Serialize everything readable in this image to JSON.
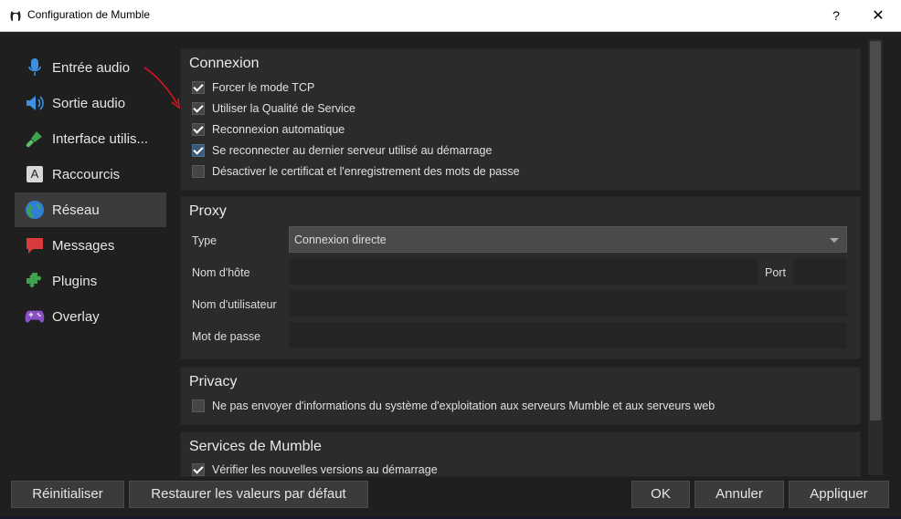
{
  "window": {
    "title": "Configuration de Mumble",
    "help_label": "?",
    "close_label": "✕"
  },
  "sidebar": {
    "items": [
      {
        "label": "Entrée audio",
        "icon": "microphone-icon",
        "active": false
      },
      {
        "label": "Sortie audio",
        "icon": "speaker-icon",
        "active": false
      },
      {
        "label": "Interface utilis...",
        "icon": "paintbrush-icon",
        "active": false
      },
      {
        "label": "Raccourcis",
        "icon": "keyboard-key-icon",
        "key_glyph": "A",
        "active": false
      },
      {
        "label": "Réseau",
        "icon": "globe-icon",
        "active": true
      },
      {
        "label": "Messages",
        "icon": "speech-bubble-icon",
        "active": false
      },
      {
        "label": "Plugins",
        "icon": "puzzle-icon",
        "active": false
      },
      {
        "label": "Overlay",
        "icon": "gamepad-icon",
        "active": false
      }
    ]
  },
  "connexion": {
    "title": "Connexion",
    "options": [
      {
        "label": "Forcer le mode TCP",
        "checked": true
      },
      {
        "label": "Utiliser la Qualité de Service",
        "checked": true
      },
      {
        "label": "Reconnexion automatique",
        "checked": true
      },
      {
        "label": "Se reconnecter au dernier serveur utilisé au démarrage",
        "checked": true
      },
      {
        "label": "Désactiver le certificat et l'enregistrement des mots de passe",
        "checked": false
      }
    ]
  },
  "proxy": {
    "title": "Proxy",
    "type_label": "Type",
    "type_value": "Connexion directe",
    "host_label": "Nom d'hôte",
    "host_value": "",
    "port_label": "Port",
    "port_value": "",
    "user_label": "Nom d'utilisateur",
    "user_value": "",
    "password_label": "Mot de passe",
    "password_value": ""
  },
  "privacy": {
    "title": "Privacy",
    "option_label": "Ne pas envoyer d'informations du système d'exploitation aux serveurs Mumble et aux serveurs web",
    "option_checked": false
  },
  "services": {
    "title": "Services de Mumble",
    "option_label": "Vérifier les nouvelles versions au démarrage",
    "option_checked": true
  },
  "buttons": {
    "reset": "Réinitialiser",
    "defaults": "Restaurer les valeurs par défaut",
    "ok": "OK",
    "cancel": "Annuler",
    "apply": "Appliquer"
  },
  "colors": {
    "background": "#1f1f1f",
    "panel": "#2b2b2b",
    "annotation_arrow": "#e0141e"
  }
}
